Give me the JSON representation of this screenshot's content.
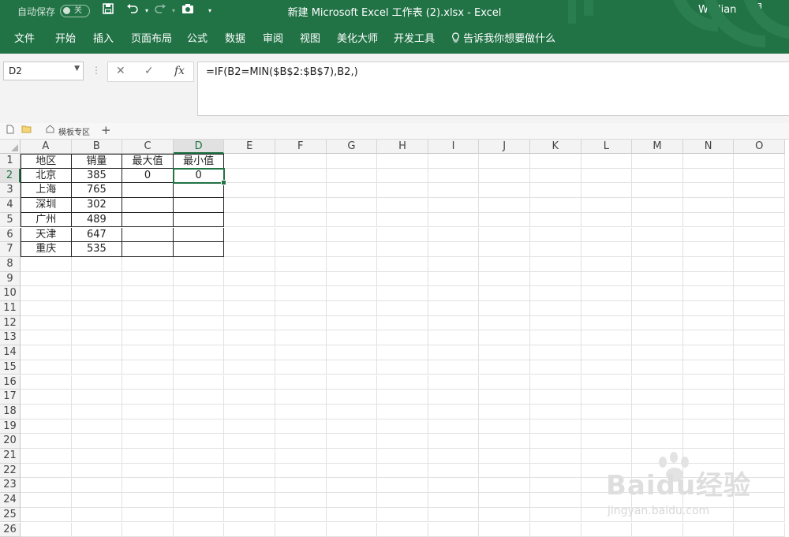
{
  "titlebar": {
    "autosave_label": "自动保存",
    "autosave_state": "关",
    "doc_title": "新建 Microsoft Excel 工作表 (2).xlsx  -  Excel",
    "user": "Wu Jian"
  },
  "ribbon": {
    "tabs": [
      "文件",
      "开始",
      "插入",
      "页面布局",
      "公式",
      "数据",
      "审阅",
      "视图",
      "美化大师",
      "开发工具"
    ],
    "tell_me": "告诉我你想要做什么"
  },
  "formula_bar": {
    "name_box": "D2",
    "formula": "=IF(B2=MIN($B$2:$B$7),B2,)"
  },
  "template_bar": {
    "label": "模板专区"
  },
  "sheet": {
    "columns": [
      "A",
      "B",
      "C",
      "D",
      "E",
      "F",
      "G",
      "H",
      "I",
      "J",
      "K",
      "L",
      "M",
      "N",
      "O"
    ],
    "rows": [
      "1",
      "2",
      "3",
      "4",
      "5",
      "6",
      "7",
      "8",
      "9",
      "10",
      "11",
      "12",
      "13",
      "14",
      "15",
      "16",
      "17",
      "18",
      "19",
      "20",
      "21",
      "22",
      "23",
      "24",
      "25",
      "26"
    ],
    "selected_cell": "D2",
    "table": [
      [
        "地区",
        "销量",
        "最大值",
        "最小值"
      ],
      [
        "北京",
        "385",
        "0",
        "0"
      ],
      [
        "上海",
        "765",
        "",
        ""
      ],
      [
        "深圳",
        "302",
        "",
        ""
      ],
      [
        "广州",
        "489",
        "",
        ""
      ],
      [
        "天津",
        "647",
        "",
        ""
      ],
      [
        "重庆",
        "535",
        "",
        ""
      ]
    ]
  },
  "watermark": {
    "brand": "Baidu经验",
    "sub": "jingyan.baidu.com"
  },
  "colors": {
    "accent": "#217346"
  }
}
